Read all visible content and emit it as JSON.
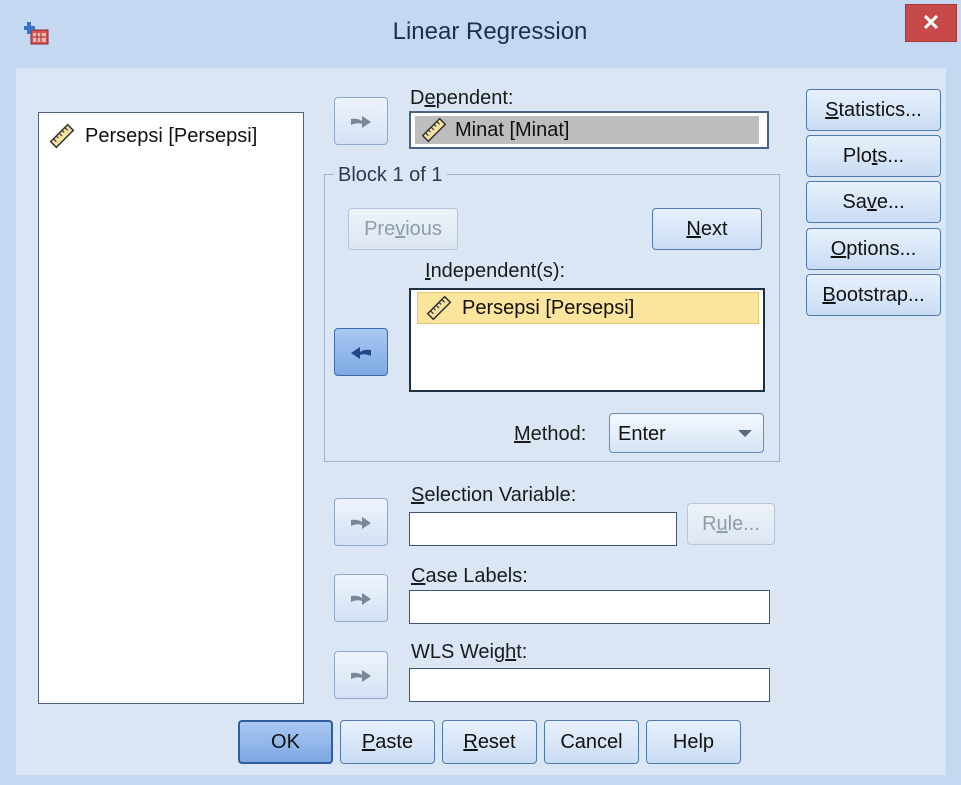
{
  "window": {
    "title": "Linear Regression",
    "close_label": "✕"
  },
  "variable_list": {
    "items": [
      {
        "label": "Persepsi [Persepsi]",
        "icon": "scale-ruler-icon"
      }
    ]
  },
  "dependent": {
    "label_pre": "D",
    "label_ul": "e",
    "label_post": "pendent:",
    "value": "Minat [Minat]"
  },
  "block": {
    "title": "Block 1 of 1",
    "previous_pre": "Pre",
    "previous_ul": "v",
    "previous_post": "ious",
    "next_ul": "N",
    "next_post": "ext"
  },
  "independents": {
    "label_pre": "",
    "label_ul": "I",
    "label_post": "ndependent(s):",
    "items": [
      "Persepsi [Persepsi]"
    ]
  },
  "method": {
    "label_ul": "M",
    "label_post": "ethod:",
    "value": "Enter"
  },
  "selection_variable": {
    "label_pre": "",
    "label_ul": "S",
    "label_post": "election Variable:",
    "value": "",
    "rule_pre": "R",
    "rule_ul": "u",
    "rule_post": "le..."
  },
  "case_labels": {
    "label_pre": "",
    "label_ul": "C",
    "label_post": "ase Labels:",
    "value": ""
  },
  "wls_weight": {
    "label_pre": "WLS Weig",
    "label_ul": "h",
    "label_post": "t:",
    "value": ""
  },
  "side_buttons": {
    "statistics_ul": "S",
    "statistics_post": "tatistics...",
    "plots_pre": "Plo",
    "plots_ul": "t",
    "plots_post": "s...",
    "save_pre": "Sa",
    "save_ul": "v",
    "save_post": "e...",
    "options_ul": "O",
    "options_post": "ptions...",
    "bootstrap_ul": "B",
    "bootstrap_post": "ootstrap..."
  },
  "bottom_buttons": {
    "ok": "OK",
    "paste_ul": "P",
    "paste_post": "aste",
    "reset_ul": "R",
    "reset_post": "eset",
    "cancel": "Cancel",
    "help": "Help"
  },
  "colors": {
    "frame": "#c4d8f2",
    "client": "#dbe6f5",
    "close": "#c74a48",
    "selection": "#fbe59c"
  }
}
